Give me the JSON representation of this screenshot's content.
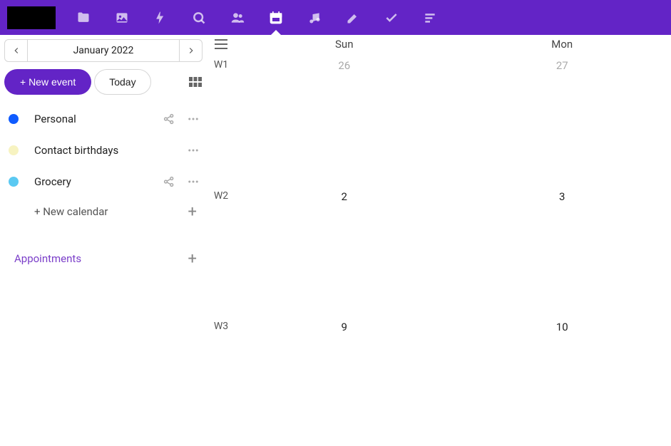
{
  "header": {
    "nav_items": [
      {
        "name": "files-icon",
        "active": false
      },
      {
        "name": "photos-icon",
        "active": false
      },
      {
        "name": "activity-icon",
        "active": false
      },
      {
        "name": "search-icon",
        "active": false
      },
      {
        "name": "contacts-icon",
        "active": false
      },
      {
        "name": "calendar-icon",
        "active": true
      },
      {
        "name": "music-icon",
        "active": false
      },
      {
        "name": "notes-icon",
        "active": false
      },
      {
        "name": "tasks-icon",
        "active": false
      },
      {
        "name": "list-icon",
        "active": false
      }
    ]
  },
  "sidebar": {
    "current_period": "January 2022",
    "new_event_label": "+ New event",
    "today_label": "Today",
    "calendars": [
      {
        "label": "Personal",
        "color": "#0f5bff",
        "shareable": true
      },
      {
        "label": "Contact birthdays",
        "color": "#f7f3c1",
        "shareable": false
      },
      {
        "label": "Grocery",
        "color": "#5bc9f2",
        "shareable": true
      }
    ],
    "new_calendar_label": "+ New calendar",
    "appointments_label": "Appointments"
  },
  "calendar": {
    "day_headers": [
      "Sun",
      "Mon"
    ],
    "weeks": [
      {
        "label": "W1",
        "days": [
          {
            "num": "26",
            "muted": true
          },
          {
            "num": "27",
            "muted": true
          }
        ]
      },
      {
        "label": "W2",
        "days": [
          {
            "num": "2",
            "muted": false
          },
          {
            "num": "3",
            "muted": false
          }
        ]
      },
      {
        "label": "W3",
        "days": [
          {
            "num": "9",
            "muted": false
          },
          {
            "num": "10",
            "muted": false
          }
        ]
      }
    ]
  }
}
